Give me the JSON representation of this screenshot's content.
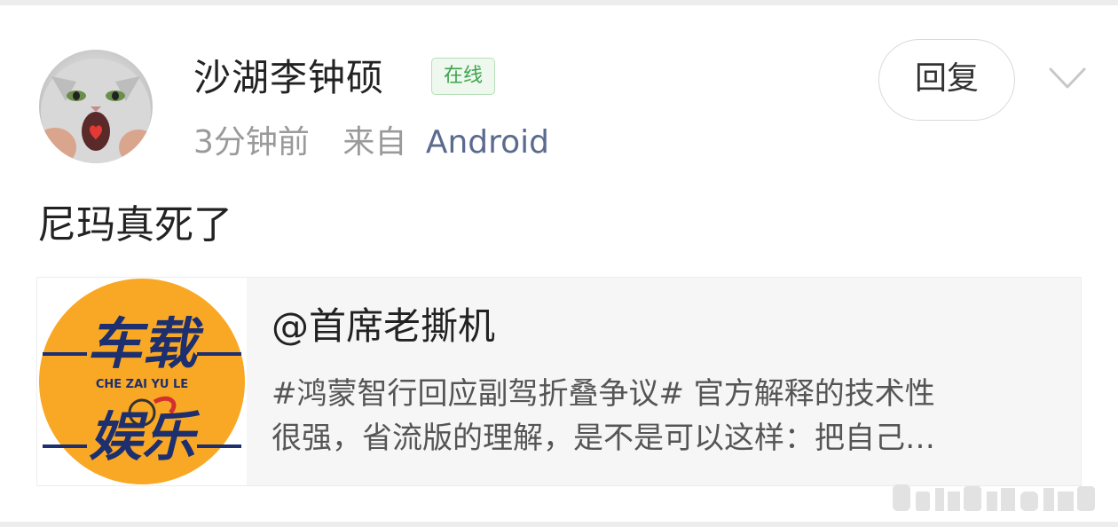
{
  "post": {
    "username": "沙湖李钟硕",
    "online_badge": "在线",
    "time": "3分钟前",
    "from_label": "来自",
    "source": "Android",
    "reply_label": "回复",
    "text": "尼玛真死了"
  },
  "quote": {
    "author": "@首席老撕机",
    "excerpt_line1": "#鸿蒙智行回应副驾折叠争议# 官方解释的技术性",
    "excerpt_line2": "很强，省流版的理解，是不是可以这样：把自己…",
    "thumbnail_logo_text_top": "车载",
    "thumbnail_logo_text_pinyin": "CHE ZAI YU LE",
    "thumbnail_logo_text_bottom": "娱乐"
  },
  "colors": {
    "online_green": "#3fa34d",
    "source_blue": "#5b6b8f",
    "logo_orange": "#f9a825",
    "logo_navy": "#1d2f6f",
    "logo_red": "#d32f2f"
  },
  "icons": {
    "more": "chevron-down-icon",
    "avatar": "cat-avatar"
  }
}
